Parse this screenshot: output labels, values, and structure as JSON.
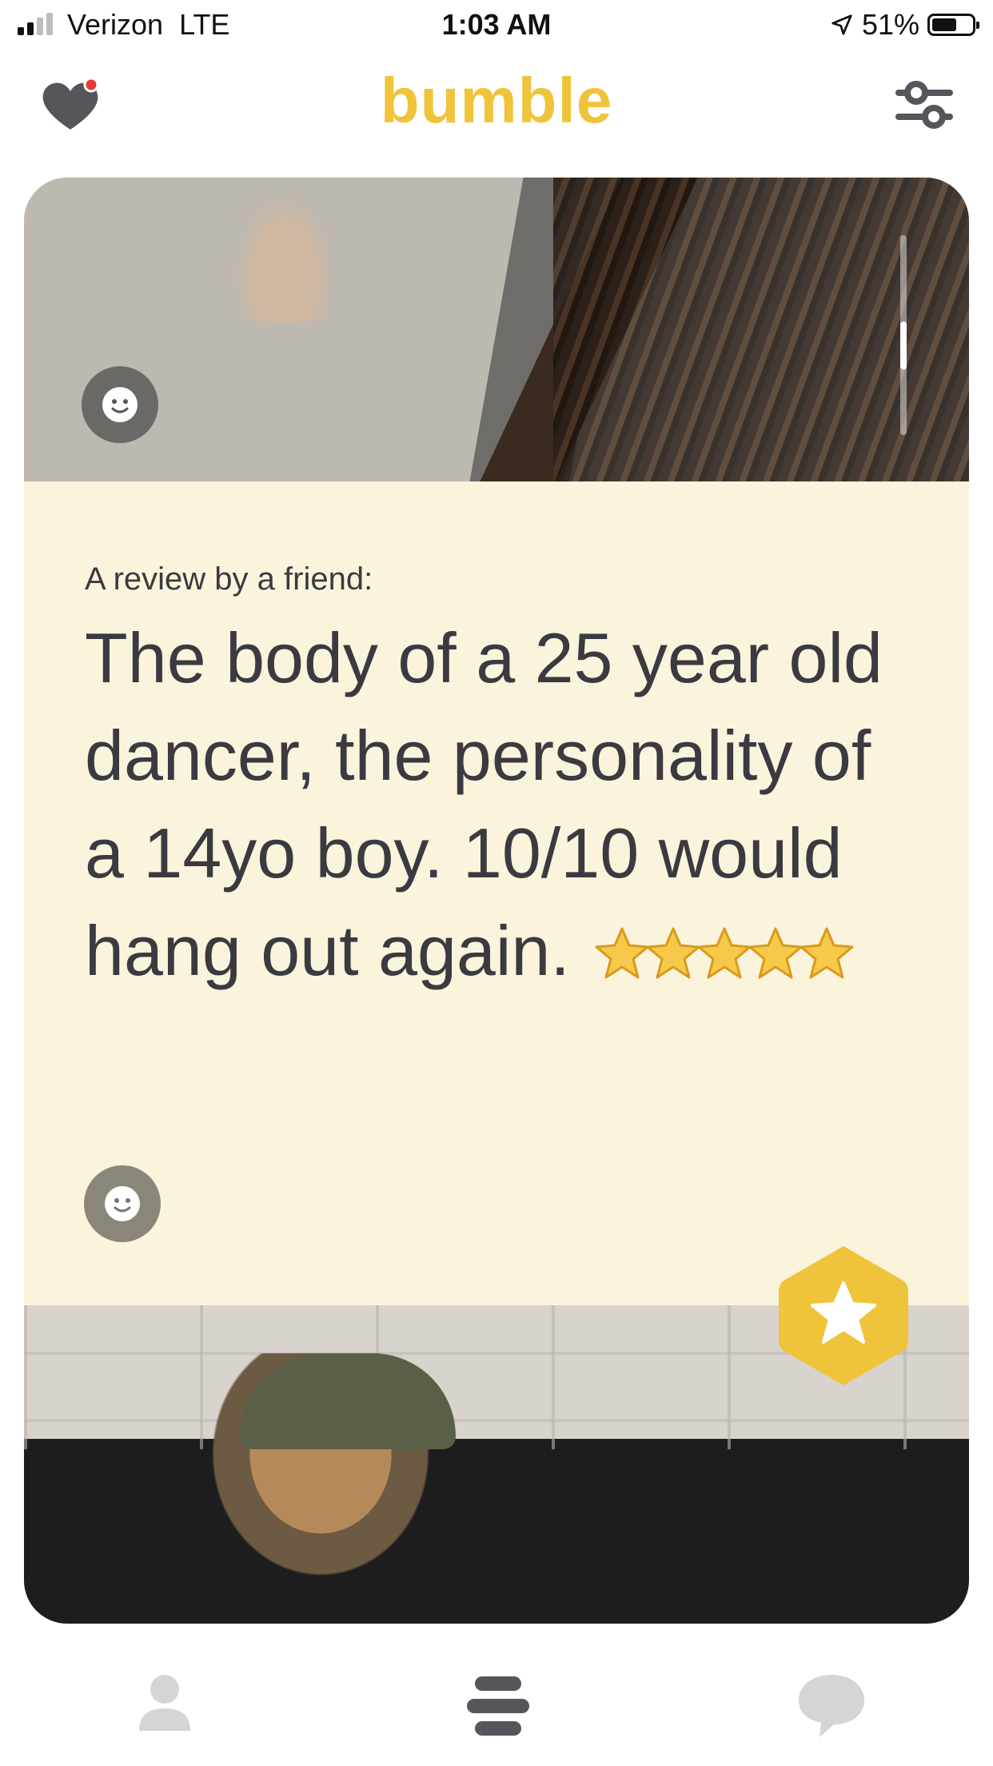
{
  "status_bar": {
    "carrier": "Verizon",
    "network": "LTE",
    "time": "1:03 AM",
    "battery": "51%",
    "battery_level": 0.51
  },
  "app_bar": {
    "brand": "bumble",
    "brand_color": "#f0c43a",
    "icons": [
      "heart-icon",
      "filter-sliders-icon"
    ],
    "notification_dot_color": "#e53935"
  },
  "card": {
    "review_label": "A review by a friend:",
    "review_text": "The body of a 25 year old dancer, the personality of a 14yo boy. 10/10 would hang out again.",
    "review_stars": 5,
    "icons": [
      "smile-icon",
      "superswipe-star-icon"
    ],
    "accent_color": "#f0c43a",
    "background_color": "#fbf4dc"
  },
  "bottom_nav": {
    "icons": [
      "profile-icon",
      "swipe-stack-icon",
      "chat-bubble-icon"
    ]
  }
}
